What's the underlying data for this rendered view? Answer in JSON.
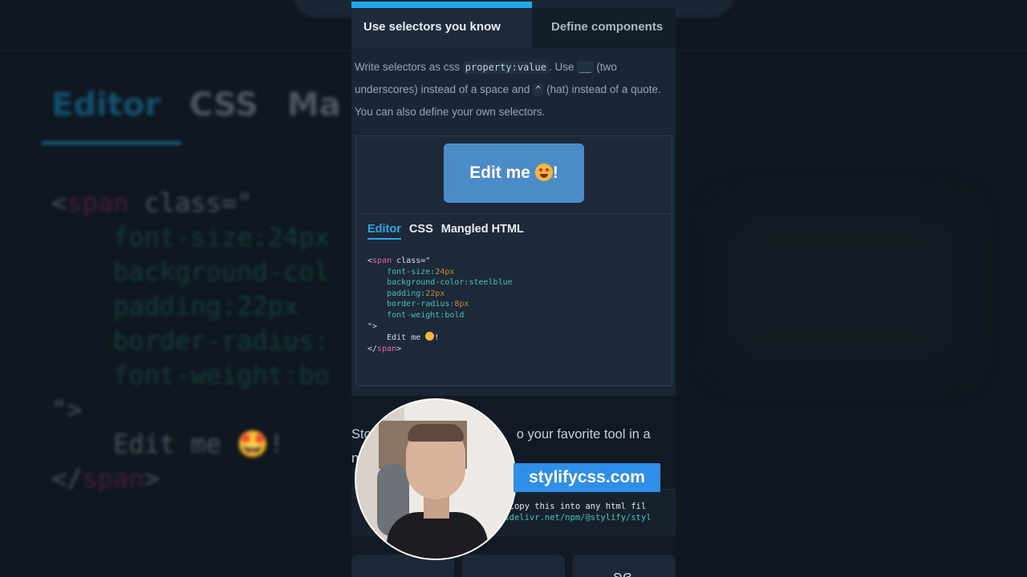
{
  "background": {
    "tabs": [
      "Editor",
      "CSS",
      "Ma"
    ],
    "code_lines": [
      {
        "parts": [
          [
            "pun",
            "<"
          ],
          [
            "tag",
            "span"
          ],
          [
            "txt",
            " class=\""
          ]
        ]
      },
      {
        "parts": [
          [
            "prop",
            "    font-size:24px"
          ]
        ]
      },
      {
        "parts": [
          [
            "prop",
            "    background-col"
          ]
        ]
      },
      {
        "parts": [
          [
            "prop",
            "    padding:22px"
          ]
        ]
      },
      {
        "parts": [
          [
            "prop",
            "    border-radius:"
          ]
        ]
      },
      {
        "parts": [
          [
            "prop",
            "    font-weight:bo"
          ]
        ]
      },
      {
        "parts": [
          [
            "txt",
            "\">"
          ]
        ]
      },
      {
        "parts": [
          [
            "txt",
            "    Edit me 🤩!"
          ]
        ]
      },
      {
        "parts": [
          [
            "pun",
            "</"
          ],
          [
            "tag",
            "span"
          ],
          [
            "pun",
            ">"
          ]
        ]
      }
    ]
  },
  "tabs": {
    "active": "Use selectors you know",
    "next": "Define components"
  },
  "description": {
    "part1": "Write selectors as css ",
    "code1": "property:value",
    "part2": ". Use ",
    "code2": "__",
    "part3": " (two underscores) instead of a space and ",
    "code3": "^",
    "part4": " (hat) instead of a quote. You can also define your own selectors."
  },
  "preview": {
    "button_label": "Edit me",
    "button_suffix": "!"
  },
  "editor": {
    "tabs": [
      "Editor",
      "CSS",
      "Mangled HTML"
    ],
    "code": {
      "open_tag": "span",
      "attr": " class=\"",
      "lines": [
        {
          "prop": "font-size:",
          "val": "24px"
        },
        {
          "prop": "background-color:steelblue",
          "val": ""
        },
        {
          "prop": "padding:",
          "val": "22px"
        },
        {
          "prop": "border-radius:",
          "val": "8px"
        },
        {
          "prop": "font-weight:bold",
          "val": ""
        }
      ],
      "close_attr": "\">",
      "content": "Edit me",
      "content_suffix": "!",
      "close_tag": "span"
    }
  },
  "lower": {
    "text_before": "Sto",
    "text_after": "o your favorite tool in a",
    "text_line2": "n",
    "cdn_line1": ". Copy this into any html fil",
    "cdn_line2": "jsdelivr.net/npm/@stylify/styl"
  },
  "badge": "stylifycss.com",
  "colors": {
    "accent": "#21a8e6",
    "button": "#4b8cc8",
    "badge": "#2f8fe8"
  }
}
